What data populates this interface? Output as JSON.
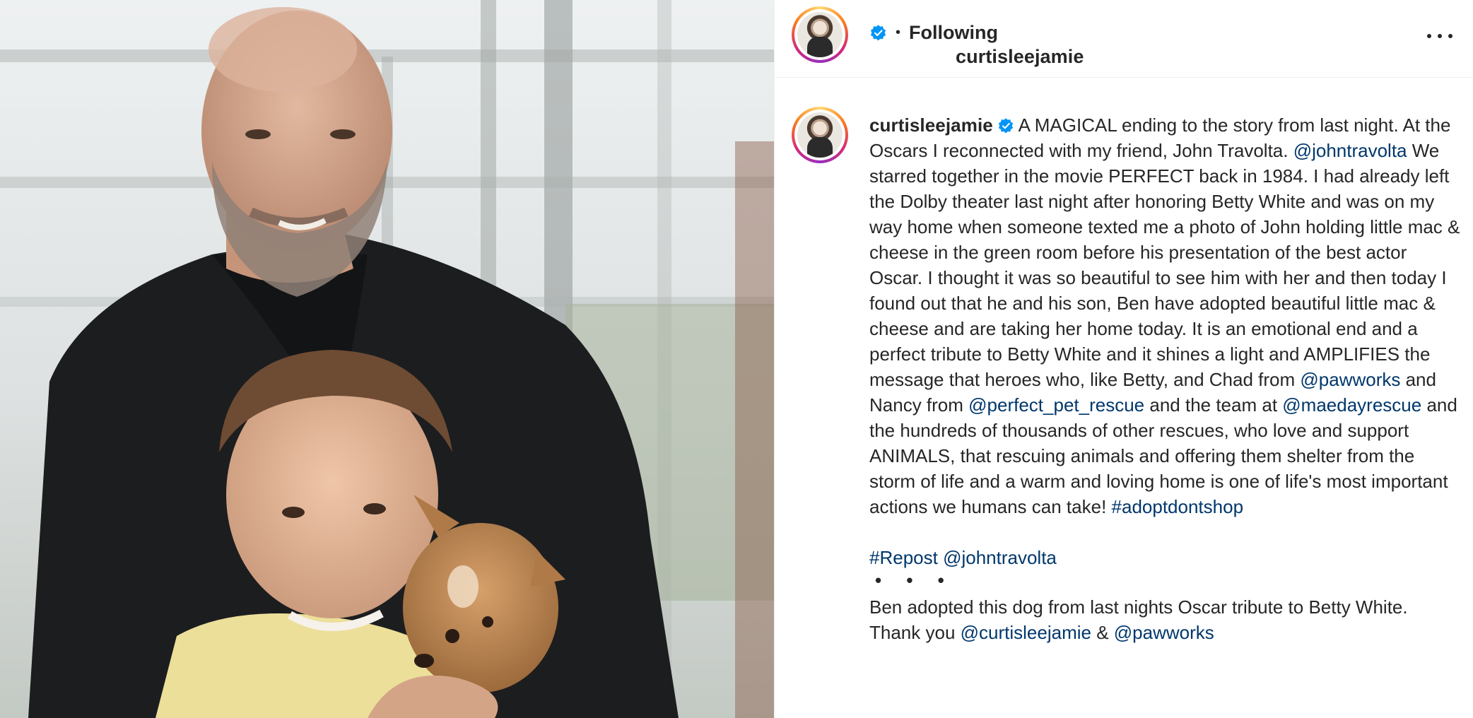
{
  "post": {
    "author": {
      "username": "curtisleejamie",
      "verified": true,
      "follow_status": "Following"
    },
    "header": {
      "separator": "•",
      "more_icon": "more-horizontal-icon"
    },
    "caption": {
      "username": "curtisleejamie",
      "parts": [
        {
          "type": "text",
          "text": " A MAGICAL ending to the story from last night. At the Oscars I reconnected with my friend, John Travolta. "
        },
        {
          "type": "link",
          "text": "@johntravolta"
        },
        {
          "type": "text",
          "text": " We starred together in the movie PERFECT back in 1984. I had already left the Dolby theater last night after honoring Betty White and was on my way home when someone texted me a photo of John holding little mac & cheese in the green room before his presentation of the best actor Oscar. I thought it was so beautiful to see him with her and then today I found out that he and his son, Ben have adopted beautiful little mac & cheese and are taking her home today. It is an emotional end and a perfect tribute to Betty White and it shines a light and AMPLIFIES the message that heroes who, like Betty, and Chad from "
        },
        {
          "type": "link",
          "text": "@pawworks"
        },
        {
          "type": "text",
          "text": " and Nancy from "
        },
        {
          "type": "link",
          "text": "@perfect_pet_rescue"
        },
        {
          "type": "text",
          "text": " and the team at "
        },
        {
          "type": "link",
          "text": "@maedayrescue"
        },
        {
          "type": "text",
          "text": " and the hundreds of thousands of other rescues, who love and support ANIMALS, that rescuing animals and offering them shelter from the storm of life and a warm and loving home is one of life's most important actions we humans can take! "
        },
        {
          "type": "link",
          "text": "#adoptdontshop"
        }
      ],
      "repost_hashtag": "#Repost",
      "repost_user": "@johntravolta",
      "dots": "• • •",
      "repost_text_1": "Ben adopted this dog from last nights Oscar tribute to Betty White. Thank you ",
      "repost_link_1": "@curtisleejamie",
      "repost_amp": " & ",
      "repost_link_2": "@pawworks"
    },
    "colors": {
      "link": "#00376b",
      "verified": "#0095f6",
      "text": "#262626"
    }
  }
}
